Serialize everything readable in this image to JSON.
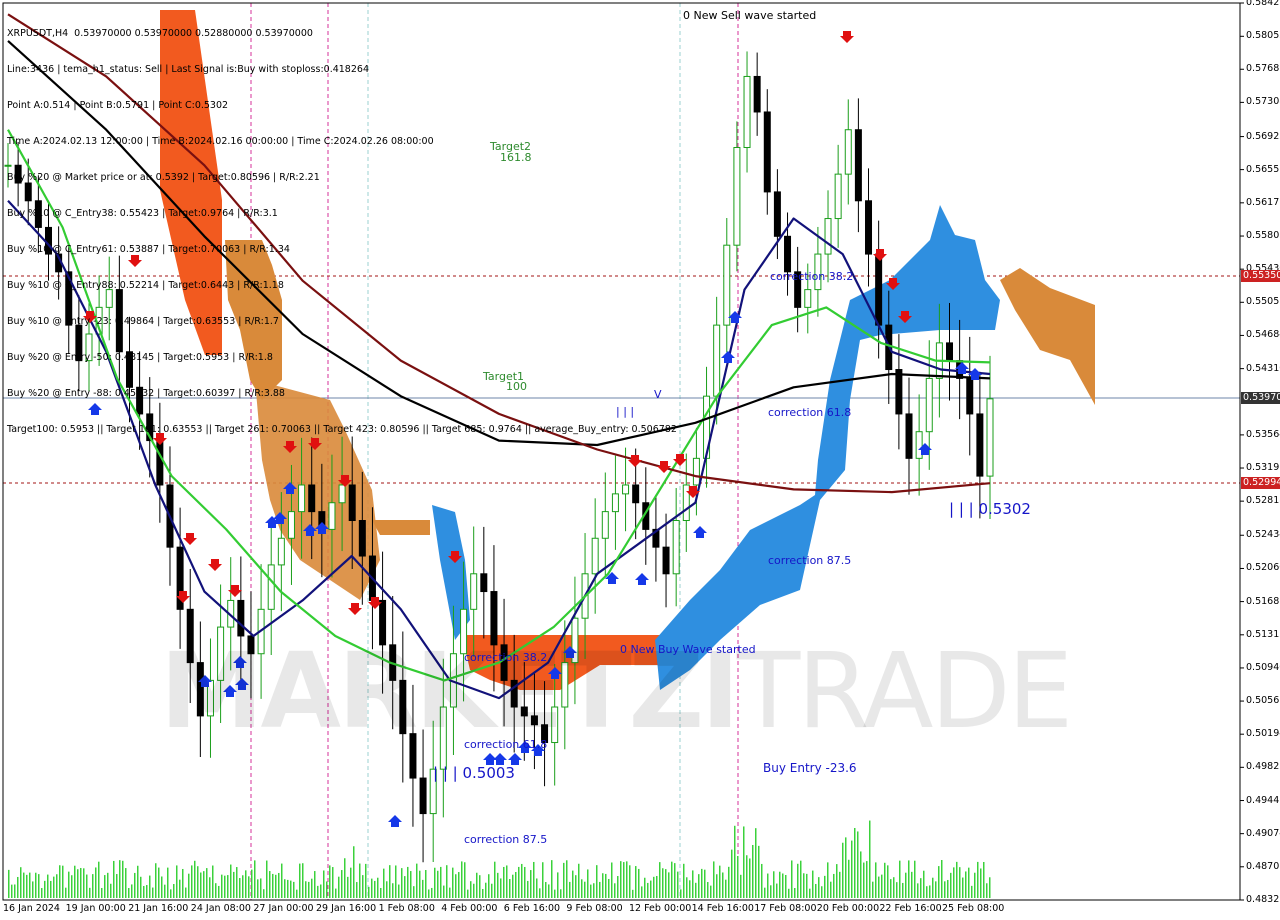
{
  "header": {
    "lines": [
      "XRPUSDT,H4  0.53970000 0.53970000 0.52880000 0.53970000",
      "Line:3436 | tema_h1_status: Sell | Last Signal is:Buy with stoploss:0.418264",
      "Point A:0.514 | Point B:0.5791 | Point C:0.5302",
      "Time A:2024.02.13 12:00:00 | Time B:2024.02.16 00:00:00 | Time C:2024.02.26 08:00:00",
      "Buy %20 @ Market price or at: 0.5392 | Target:0.80596 | R/R:2.21",
      "Buy %10 @ C_Entry38: 0.55423 | Target:0.9764 | R/R:3.1",
      "Buy %10 @ C_Entry61: 0.53887 | Target:0.70063 | R/R:1.34",
      "Buy %10 @ C_Entry88: 0.52214 | Target:0.6443 | R/R:1.18",
      "Buy %10 @ Entry -23: 0.49864 | Target:0.63553 | R/R:1.7",
      "Buy %20 @ Entry -50: 0.48145 | Target:0.5953 | R/R:1.8",
      "Buy %20 @ Entry -88: 0.45632 | Target:0.60397 | R/R:3.88",
      "Target100: 0.5953 || Target 161: 0.63553 || Target 261: 0.70063 || Target 423: 0.80596 || Target 685: 0.9764 || average_Buy_entry: 0.506782"
    ]
  },
  "watermark": {
    "bold": "MARKETZI",
    "thin": "TRADE"
  },
  "annotations": {
    "new_sell_wave": "0 New Sell wave started",
    "new_buy_wave": "0 New Buy Wave started",
    "target_161": "Target2",
    "target_161_value": "161.8",
    "target_100": "Target1",
    "target_100_value": "100",
    "correction_382_left": "correction 38.2",
    "correction_618_left": "correction 61.8",
    "correction_875_left": "correction 87.5",
    "correction_382_right": "correction 38.2",
    "correction_618_right": "correction 61.8",
    "correction_875_right": "correction 87.5",
    "point_5003": "| | | 0.5003",
    "point_5302": "| | | 0.5302",
    "buy_entry": "Buy Entry -23.6",
    "iii_mark": "| | |",
    "v_mark": "V"
  },
  "colors": {
    "bull": "#1a9e1a",
    "bear": "#000000",
    "ema_navy": "#12127a",
    "ema_green": "#33cc33",
    "sma_black": "#000000",
    "sma_darkred": "#7a1010",
    "cloud_orange": "#f25a1f",
    "cloud_brown": "#d98a3a",
    "cloud_blue": "#2f8fe0",
    "volume": "#3bd13b",
    "tag_red": "#cc2222",
    "tag_dark": "#333333"
  },
  "chart_data": {
    "type": "candlestick",
    "symbol": "XRPUSDT",
    "timeframe": "H4",
    "ylim": [
      0.48297,
      0.543
    ],
    "y_ticks": [
      "0.58427",
      "0.58052",
      "0.57681",
      "0.57308",
      "0.56923",
      "0.56551",
      "0.56177",
      "0.55803",
      "0.55430",
      "0.55057",
      "0.54684",
      "0.54310",
      "0.53564",
      "0.53191",
      "0.52818",
      "0.52434",
      "0.52060",
      "0.51687",
      "0.51313",
      "0.50940",
      "0.50567",
      "0.50194",
      "0.49821",
      "0.49447",
      "0.49074",
      "0.48701",
      "0.48327"
    ],
    "x_ticks": [
      "16 Jan 2024",
      "19 Jan 00:00",
      "21 Jan 16:00",
      "24 Jan 08:00",
      "27 Jan 00:00",
      "29 Jan 16:00",
      "1 Feb 08:00",
      "4 Feb 00:00",
      "6 Feb 16:00",
      "9 Feb 08:00",
      "12 Feb 00:00",
      "14 Feb 16:00",
      "17 Feb 08:00",
      "20 Feb 00:00",
      "22 Feb 16:00",
      "25 Feb 08:00"
    ],
    "price_tags": [
      {
        "value": "0.55350",
        "style": "red"
      },
      {
        "value": "0.53970",
        "style": "dark"
      },
      {
        "value": "0.52994",
        "style": "red"
      }
    ],
    "candles_close": [
      0.566,
      0.564,
      0.562,
      0.559,
      0.556,
      0.554,
      0.548,
      0.544,
      0.547,
      0.55,
      0.552,
      0.545,
      0.541,
      0.538,
      0.535,
      0.53,
      0.523,
      0.516,
      0.51,
      0.504,
      0.508,
      0.514,
      0.517,
      0.513,
      0.511,
      0.516,
      0.521,
      0.524,
      0.527,
      0.53,
      0.527,
      0.525,
      0.528,
      0.53,
      0.526,
      0.522,
      0.517,
      0.512,
      0.508,
      0.502,
      0.497,
      0.493,
      0.498,
      0.505,
      0.511,
      0.516,
      0.52,
      0.518,
      0.512,
      0.508,
      0.505,
      0.504,
      0.503,
      0.501,
      0.505,
      0.51,
      0.515,
      0.52,
      0.524,
      0.527,
      0.529,
      0.53,
      0.528,
      0.525,
      0.523,
      0.52,
      0.526,
      0.53,
      0.533,
      0.54,
      0.548,
      0.557,
      0.568,
      0.576,
      0.572,
      0.563,
      0.558,
      0.554,
      0.55,
      0.552,
      0.556,
      0.56,
      0.565,
      0.57,
      0.562,
      0.556,
      0.548,
      0.543,
      0.538,
      0.533,
      0.536,
      0.542,
      0.546,
      0.544,
      0.542,
      0.538,
      0.531,
      0.5397
    ],
    "series": [
      {
        "name": "EMA fast",
        "values": [
          0.562,
          0.556,
          0.545,
          0.53,
          0.518,
          0.513,
          0.517,
          0.522,
          0.516,
          0.508,
          0.506,
          0.51,
          0.52,
          0.524,
          0.528,
          0.552,
          0.56,
          0.556,
          0.545,
          0.543,
          0.5425
        ]
      },
      {
        "name": "EMA slow",
        "values": [
          0.57,
          0.559,
          0.542,
          0.531,
          0.525,
          0.518,
          0.513,
          0.51,
          0.508,
          0.51,
          0.514,
          0.52,
          0.53,
          0.54,
          0.548,
          0.55,
          0.546,
          0.544,
          0.5438
        ]
      },
      {
        "name": "SMA 200",
        "values": [
          0.58,
          0.57,
          0.558,
          0.547,
          0.54,
          0.535,
          0.5345,
          0.537,
          0.541,
          0.5425,
          0.542
        ]
      },
      {
        "name": "SMA 400",
        "values": [
          0.583,
          0.576,
          0.566,
          0.553,
          0.544,
          0.538,
          0.534,
          0.531,
          0.5295,
          0.5292,
          0.5302
        ]
      }
    ]
  }
}
